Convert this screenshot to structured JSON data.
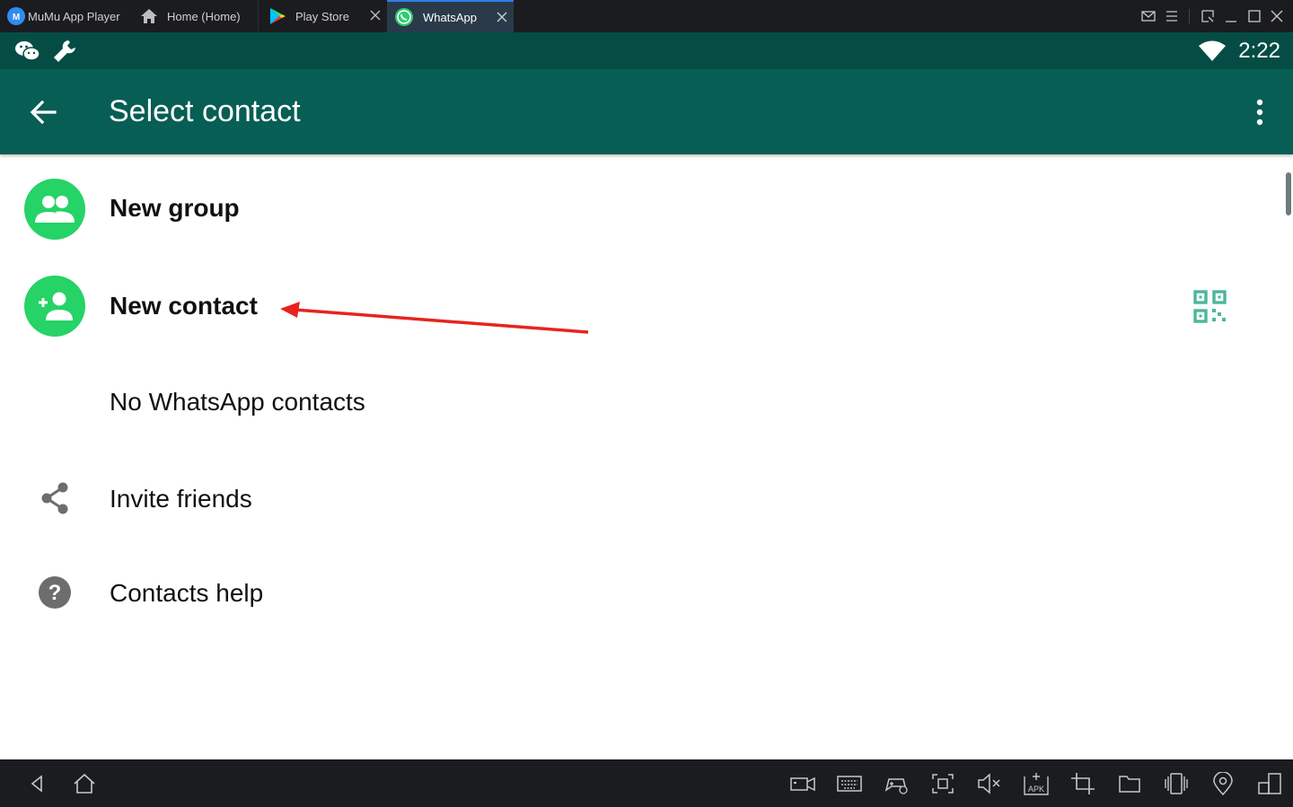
{
  "emulator": {
    "app_name": "MuMu App Player",
    "tabs": [
      {
        "label": "Home (Home)",
        "icon": "home-icon"
      },
      {
        "label": "Play Store",
        "icon": "play-store-icon"
      },
      {
        "label": "WhatsApp",
        "icon": "whatsapp-icon",
        "active": true
      }
    ]
  },
  "status_bar": {
    "time": "2:22",
    "left_icons": [
      "wechat-icon",
      "wrench-icon"
    ],
    "right_icons": [
      "wifi-icon"
    ]
  },
  "app_bar": {
    "title": "Select contact",
    "back_icon": "back-arrow-icon",
    "menu_icon": "more-vert-icon",
    "color": "#075e54"
  },
  "list": {
    "items": [
      {
        "label": "New group",
        "icon": "group-icon"
      },
      {
        "label": "New contact",
        "icon": "person-add-icon",
        "trailing_icon": "qr-code-icon"
      },
      {
        "label": "No WhatsApp contacts"
      },
      {
        "label": "Invite friends",
        "icon": "share-icon"
      },
      {
        "label": "Contacts help",
        "icon": "help-icon"
      }
    ],
    "accent": "#25d366"
  },
  "annotation": {
    "type": "arrow",
    "color": "#e8231f"
  },
  "bottom_toolbar": {
    "left": [
      "nav-back-icon",
      "nav-home-icon"
    ],
    "right": [
      "screen-record-icon",
      "keyboard-icon",
      "gamepad-icon",
      "screenshot-icon",
      "volume-mute-icon",
      "apk-install-icon",
      "crop-icon",
      "folder-icon",
      "shake-icon",
      "location-icon",
      "multi-window-icon"
    ]
  }
}
